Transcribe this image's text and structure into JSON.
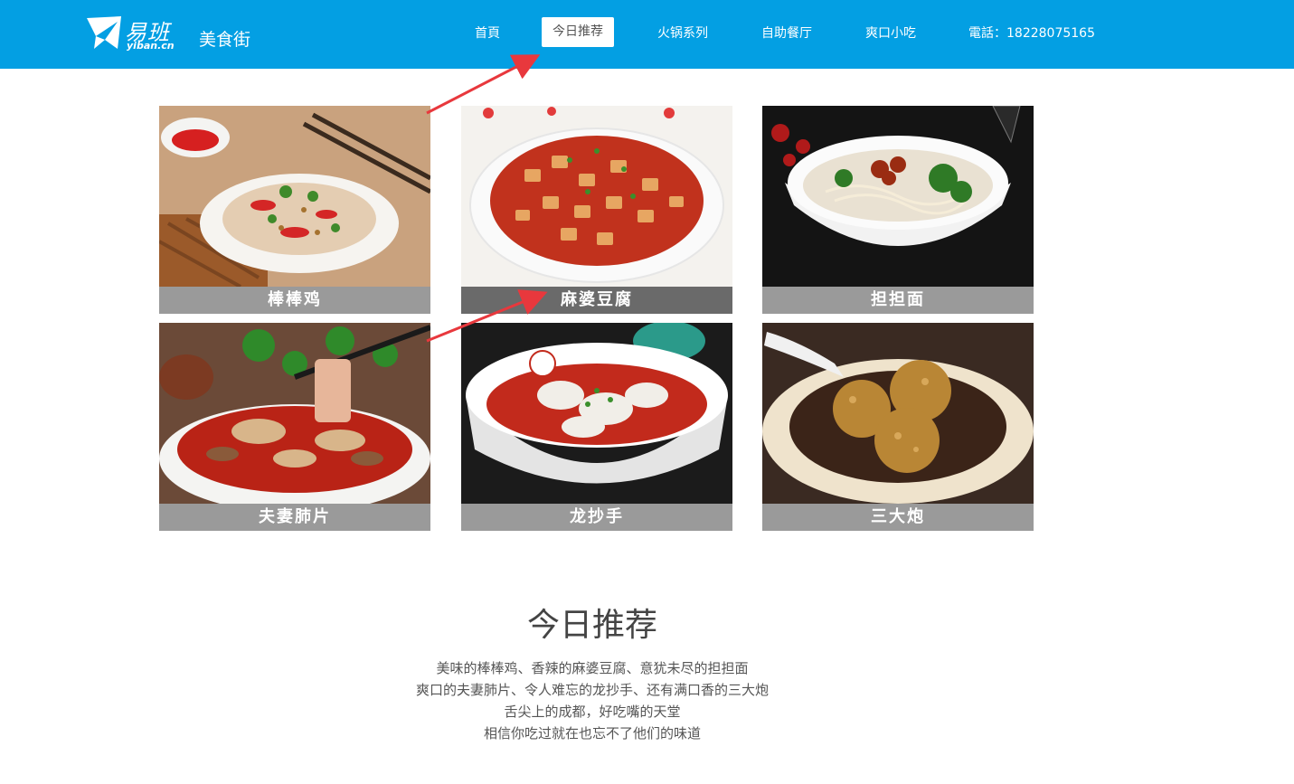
{
  "header": {
    "logo_text": "易班",
    "logo_subtext": "yiban.cn",
    "site_name": "美食街",
    "nav": [
      {
        "label": "首頁"
      },
      {
        "label": "今日推荐",
        "active": true
      },
      {
        "label": "火锅系列"
      },
      {
        "label": "自助餐厅"
      },
      {
        "label": "爽口小吃"
      },
      {
        "label": "電話：18228075165"
      }
    ],
    "colors": {
      "bar": "#039fe3",
      "active_bg": "#ffffff"
    }
  },
  "dishes": [
    {
      "name": "棒棒鸡",
      "caption_color": "#9a9a9a"
    },
    {
      "name": "麻婆豆腐",
      "caption_color": "#6a6a6a"
    },
    {
      "name": "担担面",
      "caption_color": "#9a9a9a"
    },
    {
      "name": "夫妻肺片",
      "caption_color": "#9a9a9a"
    },
    {
      "name": "龙抄手",
      "caption_color": "#9a9a9a"
    },
    {
      "name": "三大炮",
      "caption_color": "#9a9a9a"
    }
  ],
  "section": {
    "title": "今日推荐",
    "lines": [
      "美味的棒棒鸡、香辣的麻婆豆腐、意犹未尽的担担面",
      "爽口的夫妻肺片、令人难忘的龙抄手、还有满口香的三大炮",
      "舌尖上的成都，好吃嘴的天堂",
      "相信你吃过就在也忘不了他们的味道"
    ]
  },
  "annotations": {
    "arrow_color": "#e8383d"
  }
}
